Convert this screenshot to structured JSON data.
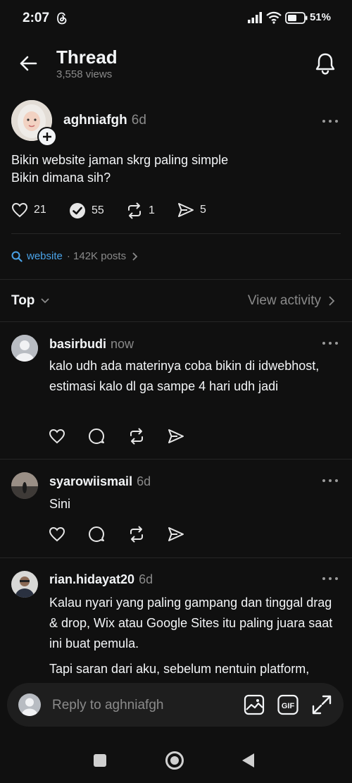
{
  "status_bar": {
    "time": "2:07",
    "battery": "51%"
  },
  "header": {
    "title": "Thread",
    "views": "3,558 views"
  },
  "post": {
    "username": "aghniafgh",
    "time": "6d",
    "text": "Bikin website jaman skrg paling simple\nBikin dimana sih?",
    "likes": "21",
    "comments": "55",
    "reposts": "1",
    "shares": "5"
  },
  "tag": {
    "label": "website",
    "posts": "· 142K posts"
  },
  "sort": {
    "label": "Top",
    "view_activity": "View activity"
  },
  "replies": [
    {
      "username": "basirbudi",
      "time": "now",
      "text": "kalo udh ada materinya coba bikin di idwebhost, estimasi kalo dl ga sampe 4 hari udh jadi"
    },
    {
      "username": "syarowiismail",
      "time": "6d",
      "text": "Sini"
    },
    {
      "username": "rian.hidayat20",
      "time": "6d",
      "text": "Kalau nyari yang paling gampang dan tinggal drag & drop, Wix atau Google Sites itu paling juara saat ini buat pemula.",
      "text2": "Tapi saran dari aku, sebelum nentuin platform,"
    }
  ],
  "reply_bar": {
    "placeholder": "Reply to aghniafgh"
  },
  "colors": {
    "background": "#101010",
    "accent": "#4aa3e8",
    "muted": "#8a8a8a"
  }
}
